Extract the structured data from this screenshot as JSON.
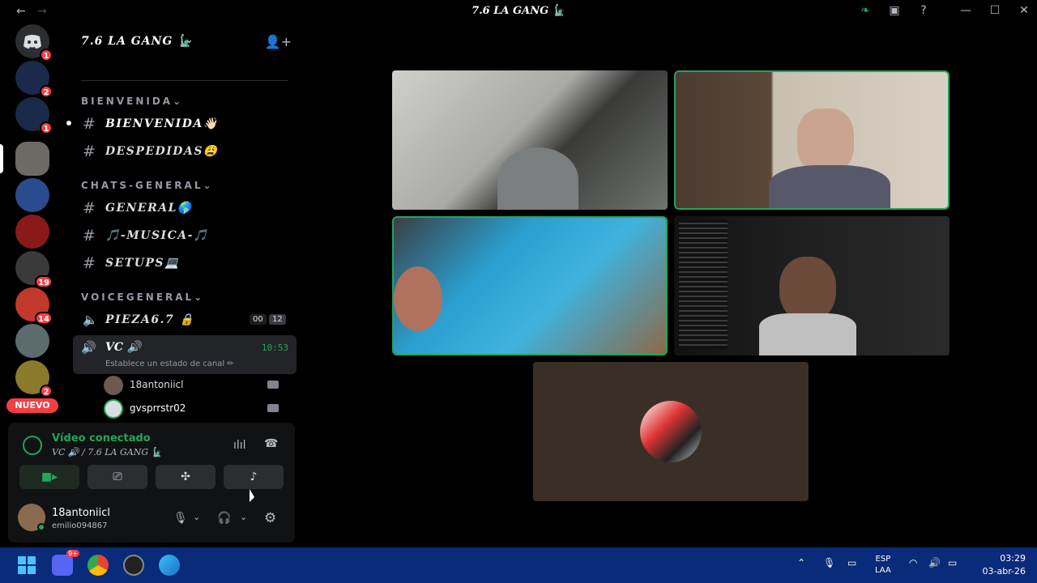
{
  "window": {
    "title": "7.6 LA GANG 🗽",
    "icons": [
      "back-arrow-icon",
      "forward-arrow-icon",
      "leaf-icon",
      "inbox-icon",
      "help-icon",
      "minimize-icon",
      "maximize-icon",
      "close-icon"
    ]
  },
  "guilds": {
    "items": [
      {
        "name": "discord-home",
        "badge": "1"
      },
      {
        "name": "server-mt-1",
        "badge": "2"
      },
      {
        "name": "server-mt-2",
        "badge": "1"
      },
      {
        "name": "server-4",
        "badge": ""
      },
      {
        "name": "server-5",
        "badge": ""
      },
      {
        "name": "server-6",
        "badge": ""
      },
      {
        "name": "server-7",
        "badge": "19"
      },
      {
        "name": "server-8",
        "badge": "14"
      },
      {
        "name": "server-9",
        "badge": ""
      },
      {
        "name": "server-10",
        "badge": "2"
      }
    ],
    "new_label": "NUEVO"
  },
  "server": {
    "name": "7.6 LA GANG 🗽",
    "categories": [
      {
        "label": "BIENVENIDA⌄",
        "channels": [
          {
            "name": "BIENVENIDA👋🏻",
            "unread": true
          },
          {
            "name": "DESPEDIDAS😩",
            "unread": false
          }
        ]
      },
      {
        "label": "CHATS-GENERAL⌄",
        "channels": [
          {
            "name": "GENERAL🌎",
            "unread": false
          },
          {
            "name": "🎵-MUSICA-🎵",
            "unread": false
          },
          {
            "name": "SETUPS💻",
            "unread": false
          }
        ]
      },
      {
        "label": "VOICEGENERAL⌄",
        "voice": [
          {
            "name": "PIEZA6.7 🔒",
            "count_a": "00",
            "count_b": "12"
          },
          {
            "name": "VC 🔊",
            "timer": "10:53",
            "status_hint": "Establece un estado de canal ✏"
          }
        ]
      }
    ],
    "voice_users": [
      "18antoniicl",
      "gvsprrstr02"
    ]
  },
  "voice_panel": {
    "title": "Vídeo conectado",
    "subtitle": "VC 🔊 / 7.6 LA GANG 🗽",
    "buttons": [
      "camera",
      "screen-share",
      "activities",
      "soundboard"
    ]
  },
  "user": {
    "name": "18antoniicl",
    "tag": "emilio094867"
  },
  "taskbar": {
    "lang_top": "ESP",
    "lang_bottom": "LAA",
    "time": "03:29",
    "date": "03-abr-26",
    "discord_badge": "9+"
  },
  "colors": {
    "accent_green": "#23a55a",
    "badge_red": "#f23f43",
    "taskbar_blue": "#0a2a7a"
  }
}
